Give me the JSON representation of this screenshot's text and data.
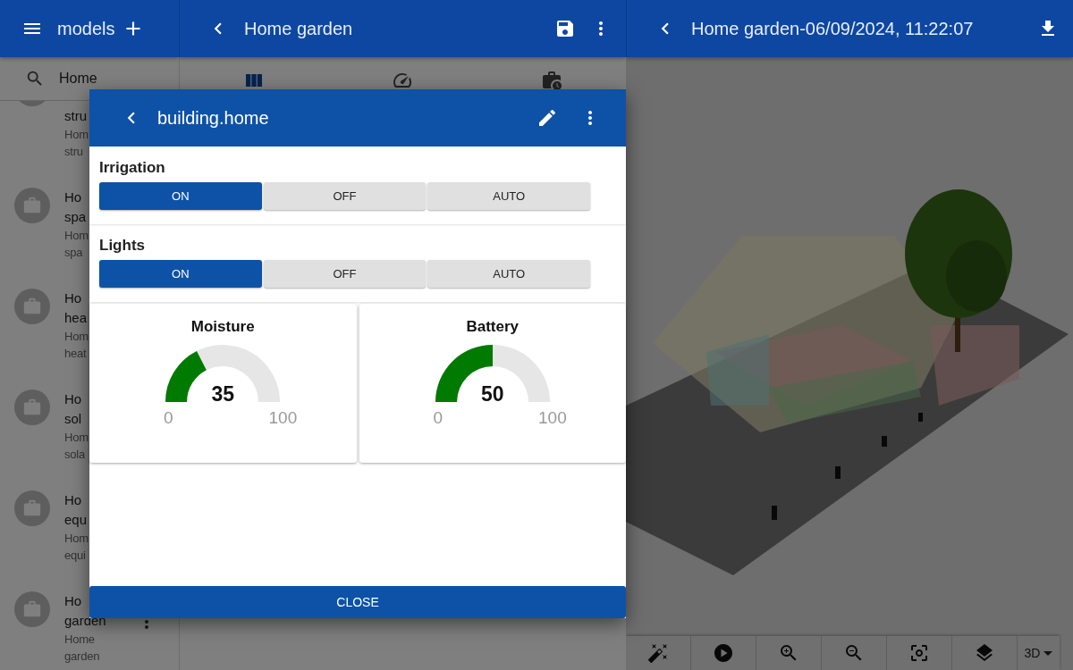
{
  "models_bar": {
    "title": "models"
  },
  "search": {
    "value": "Home"
  },
  "model_list": [
    {
      "title_lines": [
        "stru"
      ],
      "subtitle_lines": [
        "Hom",
        "stru"
      ]
    },
    {
      "title_lines": [
        "Ho",
        "spa"
      ],
      "subtitle_lines": [
        "Hom",
        "spa"
      ]
    },
    {
      "title_lines": [
        "Ho",
        "hea"
      ],
      "subtitle_lines": [
        "Hom",
        "heat"
      ]
    },
    {
      "title_lines": [
        "Ho",
        "sol"
      ],
      "subtitle_lines": [
        "Hom",
        "sola"
      ]
    },
    {
      "title_lines": [
        "Ho",
        "equ"
      ],
      "subtitle_lines": [
        "Hom",
        "equi"
      ]
    },
    {
      "title_lines": [
        "Ho",
        "garden"
      ],
      "subtitle_lines": [
        "Home",
        "garden"
      ]
    }
  ],
  "editor_bar": {
    "title": "Home garden"
  },
  "editor_tabs": [
    {
      "kind": "columns",
      "selected": true
    },
    {
      "kind": "gauge",
      "selected": false
    },
    {
      "kind": "history",
      "selected": false
    }
  ],
  "viewer_bar": {
    "title": "Home garden-06/09/2024, 11:22:07"
  },
  "viewer_toolbar": {
    "tools": [
      {
        "kind": "wand"
      },
      {
        "kind": "play"
      },
      {
        "kind": "zoom-in"
      },
      {
        "kind": "zoom-out"
      },
      {
        "kind": "focus"
      },
      {
        "kind": "layers"
      }
    ],
    "mode": "3D"
  },
  "dialog": {
    "title": "building.home",
    "controls": [
      {
        "label": "Irrigation",
        "options": [
          {
            "label": "ON",
            "selected": true
          },
          {
            "label": "OFF",
            "selected": false
          },
          {
            "label": "AUTO",
            "selected": false
          }
        ]
      },
      {
        "label": "Lights",
        "options": [
          {
            "label": "ON",
            "selected": true
          },
          {
            "label": "OFF",
            "selected": false
          },
          {
            "label": "AUTO",
            "selected": false
          }
        ]
      }
    ],
    "gauges": [
      {
        "title": "Moisture",
        "value": "35",
        "min": "0",
        "max": "100",
        "level": 0.35
      },
      {
        "title": "Battery",
        "value": "50",
        "min": "0",
        "max": "100",
        "level": 0.5
      }
    ],
    "close_label": "CLOSE"
  }
}
